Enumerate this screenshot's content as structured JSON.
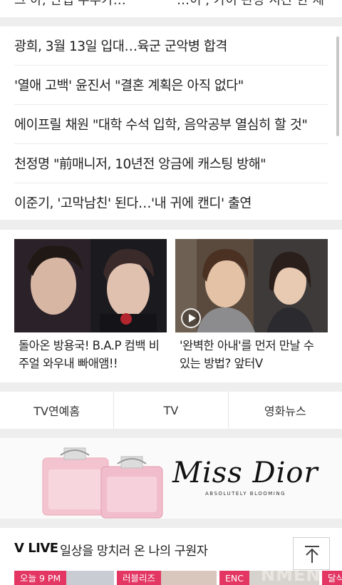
{
  "top_strip": {
    "left_text": "그 아, 만렙 주부가…",
    "right_text": "…이 , 가이 관장 시간 한 제"
  },
  "headlines": [
    "광희, 3월 13일 입대…육군 군악병 합격",
    "'열애 고백' 윤진서 \"결혼 계획은 아직 없다\"",
    "에이프릴 채원 \"대학 수석 입학, 음악공부 열심히 할 것\"",
    "천정명 \"前매니저, 10년전 앙금에 캐스팅 방해\"",
    "이준기, '고막남친' 된다…'내 귀에 캔디' 출연"
  ],
  "cards": [
    {
      "title": "돌아온 방용국! B.A.P 컴백 비주얼 와우내 빠애앰!!"
    },
    {
      "title": "'완벽한 아내'를 먼저 만날 수 있는 방법? 앞터V",
      "icon": "play-icon"
    }
  ],
  "tabs": [
    "TV연예홈",
    "TV",
    "영화뉴스"
  ],
  "ad": {
    "brand": "Miss Dior",
    "tagline": "ABSOLUTELY BLOOMING"
  },
  "vlive": {
    "title": "V LIVE",
    "subtitle": "일상을 망치러 온 나의 구원자",
    "tiles": [
      "오늘 9 PM",
      "러블리즈",
      "ENC",
      "달식"
    ],
    "tile_overlay_text": "NMENT"
  },
  "colors": {
    "badge": "#e33663",
    "background": "#eeeeee"
  }
}
